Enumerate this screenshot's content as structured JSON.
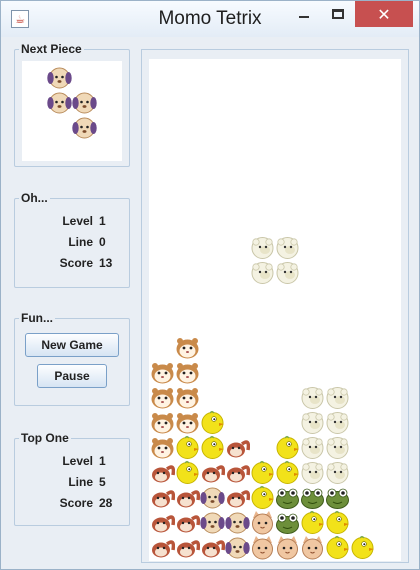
{
  "window": {
    "title": "Momo Tetrix",
    "close_glyph": "✕"
  },
  "next_piece": {
    "title": "Next Piece",
    "cells": [
      {
        "col": 1,
        "row": 0,
        "type": "puppy"
      },
      {
        "col": 1,
        "row": 1,
        "type": "puppy"
      },
      {
        "col": 2,
        "row": 1,
        "type": "puppy"
      },
      {
        "col": 2,
        "row": 2,
        "type": "puppy"
      }
    ]
  },
  "current_stats": {
    "title": "Oh...",
    "rows": [
      {
        "label": "Level",
        "value": "1"
      },
      {
        "label": "Line",
        "value": "0"
      },
      {
        "label": "Score",
        "value": "13"
      }
    ]
  },
  "fun": {
    "title": "Fun...",
    "new_game_label": "New Game",
    "pause_label": "Pause"
  },
  "top_one": {
    "title": "Top One",
    "rows": [
      {
        "label": "Level",
        "value": "1"
      },
      {
        "label": "Line",
        "value": "5"
      },
      {
        "label": "Score",
        "value": "28"
      }
    ]
  },
  "board": {
    "columns": 10,
    "rows": 20,
    "falling_piece": [
      {
        "col": 4,
        "row": 7,
        "type": "sheep"
      },
      {
        "col": 5,
        "row": 7,
        "type": "sheep"
      },
      {
        "col": 4,
        "row": 8,
        "type": "sheep"
      },
      {
        "col": 5,
        "row": 8,
        "type": "sheep"
      }
    ],
    "stack": [
      {
        "col": 1,
        "row": 11,
        "type": "hamster"
      },
      {
        "col": 0,
        "row": 12,
        "type": "hamster"
      },
      {
        "col": 1,
        "row": 12,
        "type": "hamster"
      },
      {
        "col": 0,
        "row": 13,
        "type": "hamster"
      },
      {
        "col": 1,
        "row": 13,
        "type": "hamster"
      },
      {
        "col": 6,
        "row": 13,
        "type": "sheep"
      },
      {
        "col": 7,
        "row": 13,
        "type": "sheep"
      },
      {
        "col": 0,
        "row": 14,
        "type": "hamster"
      },
      {
        "col": 1,
        "row": 14,
        "type": "hamster"
      },
      {
        "col": 2,
        "row": 14,
        "type": "chick"
      },
      {
        "col": 6,
        "row": 14,
        "type": "sheep"
      },
      {
        "col": 7,
        "row": 14,
        "type": "sheep"
      },
      {
        "col": 0,
        "row": 15,
        "type": "hamster"
      },
      {
        "col": 1,
        "row": 15,
        "type": "chick"
      },
      {
        "col": 2,
        "row": 15,
        "type": "chick"
      },
      {
        "col": 3,
        "row": 15,
        "type": "squirrel"
      },
      {
        "col": 5,
        "row": 15,
        "type": "chick"
      },
      {
        "col": 6,
        "row": 15,
        "type": "sheep"
      },
      {
        "col": 7,
        "row": 15,
        "type": "sheep"
      },
      {
        "col": 0,
        "row": 16,
        "type": "squirrel"
      },
      {
        "col": 1,
        "row": 16,
        "type": "chick"
      },
      {
        "col": 2,
        "row": 16,
        "type": "squirrel"
      },
      {
        "col": 3,
        "row": 16,
        "type": "squirrel"
      },
      {
        "col": 4,
        "row": 16,
        "type": "chick"
      },
      {
        "col": 5,
        "row": 16,
        "type": "chick"
      },
      {
        "col": 6,
        "row": 16,
        "type": "sheep"
      },
      {
        "col": 7,
        "row": 16,
        "type": "sheep"
      },
      {
        "col": 0,
        "row": 17,
        "type": "squirrel"
      },
      {
        "col": 1,
        "row": 17,
        "type": "squirrel"
      },
      {
        "col": 2,
        "row": 17,
        "type": "puppy"
      },
      {
        "col": 3,
        "row": 17,
        "type": "squirrel"
      },
      {
        "col": 4,
        "row": 17,
        "type": "chick"
      },
      {
        "col": 5,
        "row": 17,
        "type": "frog"
      },
      {
        "col": 6,
        "row": 17,
        "type": "frog"
      },
      {
        "col": 7,
        "row": 17,
        "type": "frog"
      },
      {
        "col": 0,
        "row": 18,
        "type": "squirrel"
      },
      {
        "col": 1,
        "row": 18,
        "type": "squirrel"
      },
      {
        "col": 2,
        "row": 18,
        "type": "puppy"
      },
      {
        "col": 3,
        "row": 18,
        "type": "puppy"
      },
      {
        "col": 4,
        "row": 18,
        "type": "cat"
      },
      {
        "col": 5,
        "row": 18,
        "type": "frog"
      },
      {
        "col": 6,
        "row": 18,
        "type": "chick"
      },
      {
        "col": 7,
        "row": 18,
        "type": "chick"
      },
      {
        "col": 0,
        "row": 19,
        "type": "squirrel"
      },
      {
        "col": 1,
        "row": 19,
        "type": "squirrel"
      },
      {
        "col": 2,
        "row": 19,
        "type": "squirrel"
      },
      {
        "col": 3,
        "row": 19,
        "type": "puppy"
      },
      {
        "col": 4,
        "row": 19,
        "type": "cat"
      },
      {
        "col": 5,
        "row": 19,
        "type": "cat"
      },
      {
        "col": 6,
        "row": 19,
        "type": "cat"
      },
      {
        "col": 7,
        "row": 19,
        "type": "chick"
      },
      {
        "col": 8,
        "row": 19,
        "type": "chick"
      }
    ]
  },
  "colors": {
    "window_bg": "#e9eef4",
    "close_button": "#c75050",
    "board_bg": "#ffffff"
  }
}
